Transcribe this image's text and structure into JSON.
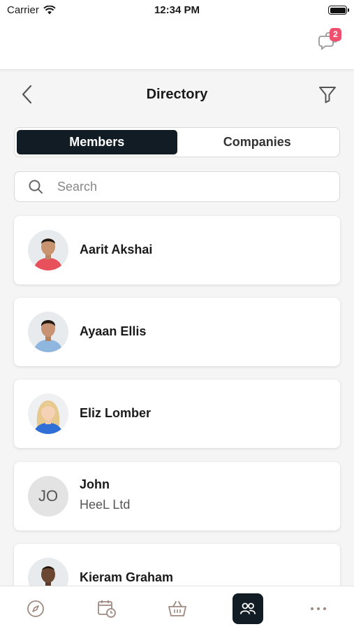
{
  "status_bar": {
    "carrier": "Carrier",
    "time": "12:34 PM"
  },
  "top_bar": {
    "notification_count": "2"
  },
  "header": {
    "title": "Directory"
  },
  "segments": {
    "members": "Members",
    "companies": "Companies",
    "selected": "Members"
  },
  "search": {
    "placeholder": "Search",
    "value": ""
  },
  "members": [
    {
      "name": "Aarit Akshai",
      "company": ""
    },
    {
      "name": "Ayaan Ellis",
      "company": ""
    },
    {
      "name": "Eliz Lomber",
      "company": ""
    },
    {
      "name": "John",
      "company": "HeeL Ltd",
      "initials": "JO"
    },
    {
      "name": "Kieram Graham",
      "company": ""
    }
  ],
  "tabs": [
    {
      "icon": "compass-icon",
      "active": false
    },
    {
      "icon": "calendar-clock-icon",
      "active": false
    },
    {
      "icon": "basket-icon",
      "active": false
    },
    {
      "icon": "people-icon",
      "active": true
    },
    {
      "icon": "more-icon",
      "active": false
    }
  ],
  "colors": {
    "active": "#111c24",
    "badge": "#f0506e",
    "background": "#f5f5f5"
  }
}
